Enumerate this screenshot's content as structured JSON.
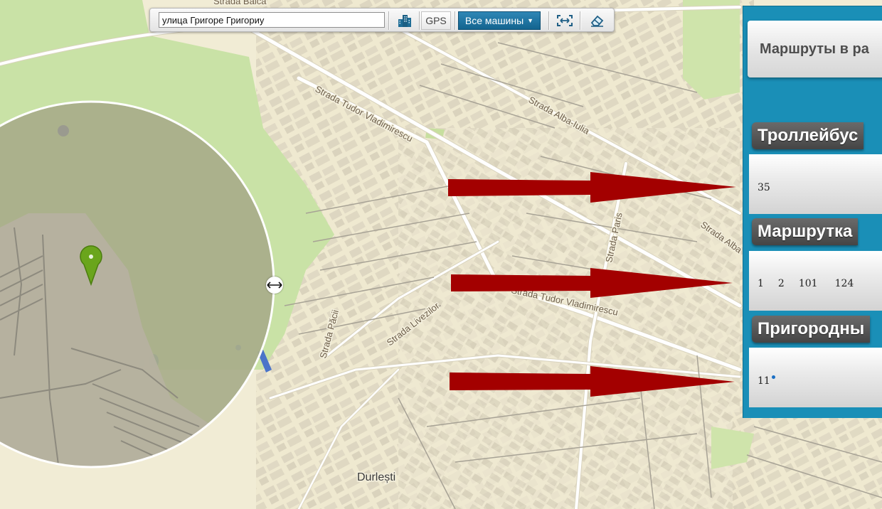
{
  "toolbar": {
    "address_value": "улица Григоре Григориу",
    "buildings_icon": "buildings-icon",
    "gps_label": "GPS",
    "cars_select_label": "Все машины",
    "fit_icon": "fit-bounds-icon",
    "eraser_icon": "eraser-icon"
  },
  "map": {
    "street_labels": [
      "Strada Balca",
      "Strada Tudor Vladimirescu",
      "Strada Alba-Iulia",
      "Strada Paris",
      "Strada Alba",
      "Strada Păcii",
      "Strada Livezilor",
      "Strada Tudor Vladimirescu"
    ],
    "place_label": "Durlești",
    "marker_icon": "location-pin-icon",
    "resize_icon": "horizontal-resize-icon",
    "colors": {
      "base": "#f1ecd5",
      "park": "#c9e2a6",
      "circle": "#a8ad8a",
      "arrow": "#a30000",
      "water": "#4a74c9"
    }
  },
  "panel": {
    "title": "Маршруты в ра",
    "sections": [
      {
        "label": "Троллейбус",
        "routes": [
          "35"
        ]
      },
      {
        "label": "Маршрутка",
        "routes": [
          "1",
          "2",
          "101",
          "124"
        ]
      },
      {
        "label": "Пригородны",
        "routes": [
          "11"
        ]
      }
    ]
  }
}
